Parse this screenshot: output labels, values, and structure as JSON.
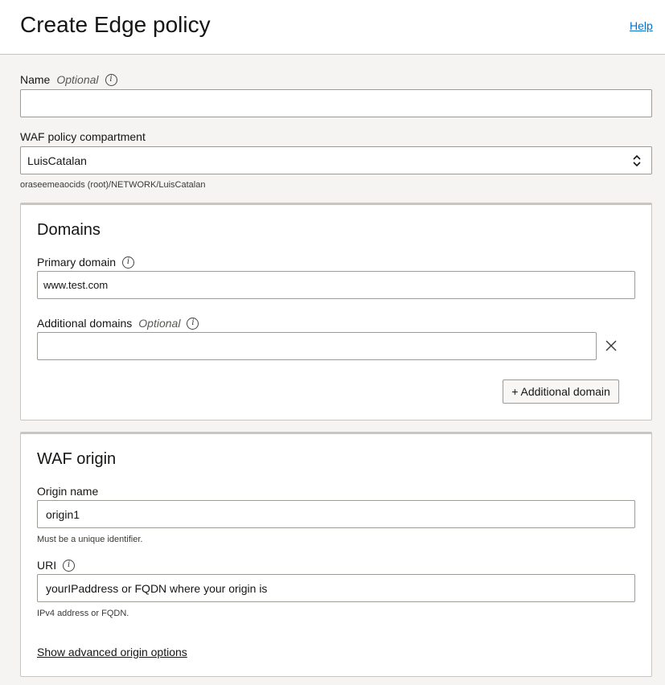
{
  "header": {
    "title": "Create Edge policy",
    "help": "Help"
  },
  "name_field": {
    "label": "Name",
    "optional": "Optional",
    "value": ""
  },
  "compartment": {
    "label": "WAF policy compartment",
    "value": "LuisCatalan",
    "path": "oraseemeaocids (root)/NETWORK/LuisCatalan"
  },
  "domains": {
    "title": "Domains",
    "primary_label": "Primary domain",
    "primary_value": "www.test.com",
    "additional_label": "Additional domains",
    "additional_optional": "Optional",
    "additional_value": "",
    "add_button": "+ Additional domain"
  },
  "origin": {
    "title": "WAF origin",
    "name_label": "Origin name",
    "name_value": "origin1",
    "name_hint": "Must be a unique identifier.",
    "uri_label": "URI",
    "uri_value": "yourIPaddress or FQDN where your origin is",
    "uri_hint": "IPv4 address or FQDN.",
    "advanced_link": "Show advanced origin options"
  }
}
